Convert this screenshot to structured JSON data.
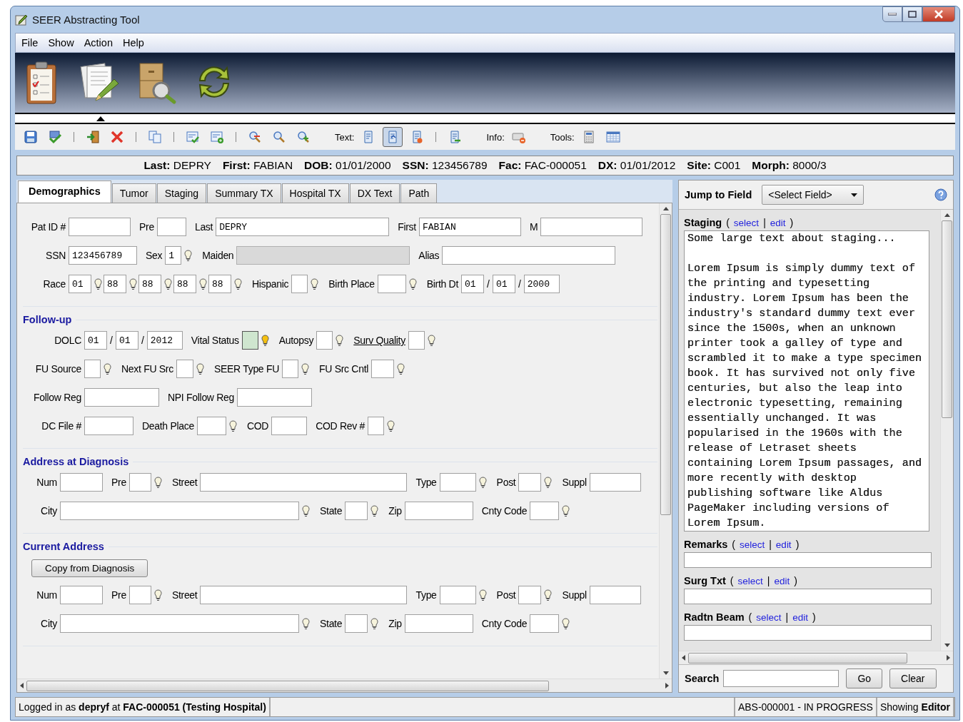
{
  "window": {
    "title": "SEER Abstracting Tool"
  },
  "menu": [
    "File",
    "Show",
    "Action",
    "Help"
  ],
  "launcher": [
    {
      "selected": false
    },
    {
      "selected": true
    },
    {
      "selected": false
    },
    {
      "selected": false
    }
  ],
  "toolbar": {
    "text_label": "Text:",
    "text_tools": [
      {
        "selected": false
      },
      {
        "selected": true
      },
      {
        "selected": false
      },
      {
        "selected": false
      }
    ],
    "info_label": "Info:",
    "tools_label": "Tools:"
  },
  "patient": [
    {
      "label": "Last:",
      "value": "DEPRY"
    },
    {
      "label": "First:",
      "value": "FABIAN"
    },
    {
      "label": "DOB:",
      "value": "01/01/2000"
    },
    {
      "label": "SSN:",
      "value": "123456789"
    },
    {
      "label": "Fac:",
      "value": "FAC-000051"
    },
    {
      "label": "DX:",
      "value": "01/01/2012"
    },
    {
      "label": "Site:",
      "value": "C001"
    },
    {
      "label": "Morph:",
      "value": "8000/3"
    }
  ],
  "tabs": [
    {
      "label": "Demographics",
      "selected": true
    },
    {
      "label": "Tumor",
      "selected": false
    },
    {
      "label": "Staging",
      "selected": false
    },
    {
      "label": "Summary TX",
      "selected": false
    },
    {
      "label": "Hospital TX",
      "selected": false
    },
    {
      "label": "DX Text",
      "selected": false
    },
    {
      "label": "Path",
      "selected": false
    }
  ],
  "form": {
    "sections": [
      {
        "rows": [
          {
            "items": [
              {
                "kind": "label",
                "text": "Pat ID #"
              },
              {
                "kind": "input",
                "disabled": false,
                "highlighted": false
              },
              {
                "kind": "label",
                "text": "Pre"
              },
              {
                "kind": "input",
                "disabled": false,
                "highlighted": false
              },
              {
                "kind": "label",
                "text": "Last"
              },
              {
                "kind": "input",
                "value": "DEPRY",
                "disabled": false,
                "highlighted": false
              },
              {
                "kind": "label",
                "text": "First"
              },
              {
                "kind": "input",
                "value": "FABIAN",
                "disabled": false,
                "highlighted": false
              },
              {
                "kind": "label",
                "text": "M"
              },
              {
                "kind": "input",
                "disabled": false,
                "highlighted": false
              }
            ]
          },
          {
            "items": [
              {
                "kind": "label",
                "text": "SSN"
              },
              {
                "kind": "input",
                "value": "123456789",
                "disabled": false,
                "highlighted": false
              },
              {
                "kind": "label",
                "text": "Sex"
              },
              {
                "kind": "input",
                "value": "1",
                "disabled": false,
                "highlighted": false
              },
              {
                "kind": "lookup",
                "lit": false
              },
              {
                "kind": "label",
                "text": "Maiden"
              },
              {
                "kind": "input",
                "disabled": true,
                "highlighted": false
              },
              {
                "kind": "label",
                "text": "Alias"
              },
              {
                "kind": "input",
                "disabled": false,
                "highlighted": false
              }
            ]
          },
          {
            "items": [
              {
                "kind": "label",
                "text": "Race"
              },
              {
                "kind": "input",
                "value": "01",
                "disabled": false,
                "highlighted": false
              },
              {
                "kind": "lookup",
                "lit": false
              },
              {
                "kind": "input",
                "value": "88",
                "disabled": false,
                "highlighted": false
              },
              {
                "kind": "lookup",
                "lit": false
              },
              {
                "kind": "input",
                "value": "88",
                "disabled": false,
                "highlighted": false
              },
              {
                "kind": "lookup",
                "lit": false
              },
              {
                "kind": "input",
                "value": "88",
                "disabled": false,
                "highlighted": false
              },
              {
                "kind": "lookup",
                "lit": false
              },
              {
                "kind": "input",
                "value": "88",
                "disabled": false,
                "highlighted": false
              },
              {
                "kind": "lookup",
                "lit": false
              },
              {
                "kind": "label",
                "text": "Hispanic"
              },
              {
                "kind": "input",
                "disabled": false,
                "highlighted": false
              },
              {
                "kind": "lookup",
                "lit": false
              },
              {
                "kind": "label",
                "text": "Birth Place"
              },
              {
                "kind": "input",
                "disabled": false,
                "highlighted": false
              },
              {
                "kind": "lookup",
                "lit": false
              },
              {
                "kind": "label",
                "text": "Birth Dt"
              },
              {
                "kind": "input",
                "value": "01",
                "disabled": false,
                "highlighted": false
              },
              {
                "kind": "sep",
                "text": "/"
              },
              {
                "kind": "input",
                "value": "01",
                "disabled": false,
                "highlighted": false
              },
              {
                "kind": "sep",
                "text": "/"
              },
              {
                "kind": "input",
                "value": "2000",
                "disabled": false,
                "highlighted": false
              }
            ]
          }
        ]
      },
      {
        "title": "Follow-up",
        "rows": [
          {
            "items": [
              {
                "kind": "label",
                "text": "DOLC"
              },
              {
                "kind": "input",
                "value": "01",
                "disabled": false,
                "highlighted": false
              },
              {
                "kind": "sep",
                "text": "/"
              },
              {
                "kind": "input",
                "value": "01",
                "disabled": false,
                "highlighted": false
              },
              {
                "kind": "sep",
                "text": "/"
              },
              {
                "kind": "input",
                "value": "2012",
                "disabled": false,
                "highlighted": false
              },
              {
                "kind": "label",
                "text": "Vital Status"
              },
              {
                "kind": "input",
                "disabled": false,
                "highlighted": true
              },
              {
                "kind": "lookup",
                "lit": true
              },
              {
                "kind": "label",
                "text": "Autopsy"
              },
              {
                "kind": "input",
                "disabled": false,
                "highlighted": false
              },
              {
                "kind": "lookup",
                "lit": false
              },
              {
                "kind": "link",
                "text": "Surv Quality"
              },
              {
                "kind": "input",
                "disabled": false,
                "highlighted": false
              },
              {
                "kind": "lookup",
                "lit": false
              }
            ]
          },
          {
            "items": [
              {
                "kind": "label",
                "text": "FU Source"
              },
              {
                "kind": "input",
                "disabled": false,
                "highlighted": false
              },
              {
                "kind": "lookup",
                "lit": false
              },
              {
                "kind": "label",
                "text": "Next FU Src"
              },
              {
                "kind": "input",
                "disabled": false,
                "highlighted": false
              },
              {
                "kind": "lookup",
                "lit": false
              },
              {
                "kind": "label",
                "text": "SEER Type FU"
              },
              {
                "kind": "input",
                "disabled": false,
                "highlighted": false
              },
              {
                "kind": "lookup",
                "lit": false
              },
              {
                "kind": "label",
                "text": "FU Src Cntl"
              },
              {
                "kind": "input",
                "disabled": false,
                "highlighted": false
              },
              {
                "kind": "lookup",
                "lit": false
              }
            ]
          },
          {
            "items": [
              {
                "kind": "label",
                "text": "Follow Reg"
              },
              {
                "kind": "input",
                "disabled": false,
                "highlighted": false
              },
              {
                "kind": "label",
                "text": "NPI Follow Reg"
              },
              {
                "kind": "input",
                "disabled": false,
                "highlighted": false
              }
            ]
          },
          {
            "items": [
              {
                "kind": "label",
                "text": "DC File #"
              },
              {
                "kind": "input",
                "disabled": false,
                "highlighted": false
              },
              {
                "kind": "label",
                "text": "Death Place"
              },
              {
                "kind": "input",
                "disabled": false,
                "highlighted": false
              },
              {
                "kind": "lookup",
                "lit": false
              },
              {
                "kind": "label",
                "text": "COD"
              },
              {
                "kind": "input",
                "disabled": false,
                "highlighted": false
              },
              {
                "kind": "label",
                "text": "COD Rev #"
              },
              {
                "kind": "input",
                "disabled": false,
                "highlighted": false
              },
              {
                "kind": "lookup",
                "lit": false
              }
            ]
          }
        ]
      },
      {
        "title": "Address at Diagnosis",
        "rows": [
          {
            "items": [
              {
                "kind": "label",
                "text": "Num"
              },
              {
                "kind": "input",
                "disabled": false,
                "highlighted": false
              },
              {
                "kind": "label",
                "text": "Pre"
              },
              {
                "kind": "input",
                "disabled": false,
                "highlighted": false
              },
              {
                "kind": "lookup",
                "lit": false
              },
              {
                "kind": "label",
                "text": "Street"
              },
              {
                "kind": "input",
                "disabled": false,
                "highlighted": false
              },
              {
                "kind": "label",
                "text": "Type"
              },
              {
                "kind": "input",
                "disabled": false,
                "highlighted": false
              },
              {
                "kind": "lookup",
                "lit": false
              },
              {
                "kind": "label",
                "text": "Post"
              },
              {
                "kind": "input",
                "disabled": false,
                "highlighted": false
              },
              {
                "kind": "lookup",
                "lit": false
              },
              {
                "kind": "label",
                "text": "Suppl"
              },
              {
                "kind": "input",
                "disabled": false,
                "highlighted": false
              }
            ]
          },
          {
            "items": [
              {
                "kind": "label",
                "text": "City"
              },
              {
                "kind": "input",
                "disabled": false,
                "highlighted": false
              },
              {
                "kind": "lookup",
                "lit": false
              },
              {
                "kind": "label",
                "text": "State"
              },
              {
                "kind": "input",
                "disabled": false,
                "highlighted": false
              },
              {
                "kind": "lookup",
                "lit": false
              },
              {
                "kind": "label",
                "text": "Zip"
              },
              {
                "kind": "input",
                "disabled": false,
                "highlighted": false
              },
              {
                "kind": "label",
                "text": "Cnty Code"
              },
              {
                "kind": "input",
                "disabled": false,
                "highlighted": false
              },
              {
                "kind": "lookup",
                "lit": false
              }
            ]
          }
        ]
      },
      {
        "title": "Current Address",
        "button": "Copy from Diagnosis",
        "rows": [
          {
            "items": [
              {
                "kind": "label",
                "text": "Num"
              },
              {
                "kind": "input",
                "disabled": false,
                "highlighted": false
              },
              {
                "kind": "label",
                "text": "Pre"
              },
              {
                "kind": "input",
                "disabled": false,
                "highlighted": false
              },
              {
                "kind": "lookup",
                "lit": false
              },
              {
                "kind": "label",
                "text": "Street"
              },
              {
                "kind": "input",
                "disabled": false,
                "highlighted": false
              },
              {
                "kind": "label",
                "text": "Type"
              },
              {
                "kind": "input",
                "disabled": false,
                "highlighted": false
              },
              {
                "kind": "lookup",
                "lit": false
              },
              {
                "kind": "label",
                "text": "Post"
              },
              {
                "kind": "input",
                "disabled": false,
                "highlighted": false
              },
              {
                "kind": "lookup",
                "lit": false
              },
              {
                "kind": "label",
                "text": "Suppl"
              },
              {
                "kind": "input",
                "disabled": false,
                "highlighted": false
              }
            ]
          },
          {
            "items": [
              {
                "kind": "label",
                "text": "City"
              },
              {
                "kind": "input",
                "disabled": false,
                "highlighted": false
              },
              {
                "kind": "lookup",
                "lit": false
              },
              {
                "kind": "label",
                "text": "State"
              },
              {
                "kind": "input",
                "disabled": false,
                "highlighted": false
              },
              {
                "kind": "lookup",
                "lit": false
              },
              {
                "kind": "label",
                "text": "Zip"
              },
              {
                "kind": "input",
                "disabled": false,
                "highlighted": false
              },
              {
                "kind": "label",
                "text": "Cnty Code"
              },
              {
                "kind": "input",
                "disabled": false,
                "highlighted": false
              },
              {
                "kind": "lookup",
                "lit": false
              }
            ]
          }
        ]
      }
    ]
  },
  "side": {
    "jump_label": "Jump to Field",
    "jump_select": "<Select Field>",
    "texts": [
      {
        "title": "Staging",
        "punct": [
          "(",
          "|",
          ")"
        ],
        "links": [
          "select",
          "edit"
        ],
        "text": "Some large text about staging...\n\nLorem Ipsum is simply dummy text of the printing and typesetting industry. Lorem Ipsum has been the industry's standard dummy text ever since the 1500s, when an unknown printer took a galley of type and scrambled it to make a type specimen book. It has survived not only five centuries, but also the leap into electronic typesetting, remaining essentially unchanged. It was popularised in the 1960s with the release of Letraset sheets containing Lorem Ipsum passages, and more recently with desktop publishing software like Aldus PageMaker including versions of Lorem Ipsum."
      },
      {
        "title": "Remarks",
        "punct": [
          "(",
          "|",
          ")"
        ],
        "links": [
          "select",
          "edit"
        ]
      },
      {
        "title": "Surg Txt",
        "punct": [
          "(",
          "|",
          ")"
        ],
        "links": [
          "select",
          "edit"
        ]
      },
      {
        "title": "Radtn Beam",
        "punct": [
          "(",
          "|",
          ")"
        ],
        "links": [
          "select",
          "edit"
        ]
      }
    ],
    "search_label": "Search",
    "buttons": [
      "Go",
      "Clear"
    ]
  },
  "status_bar": [
    "Logged in as **depryf** at **FAC-000051 (Testing Hospital)**",
    "ABS-000001 - IN PROGRESS",
    "Showing **Editor**"
  ]
}
